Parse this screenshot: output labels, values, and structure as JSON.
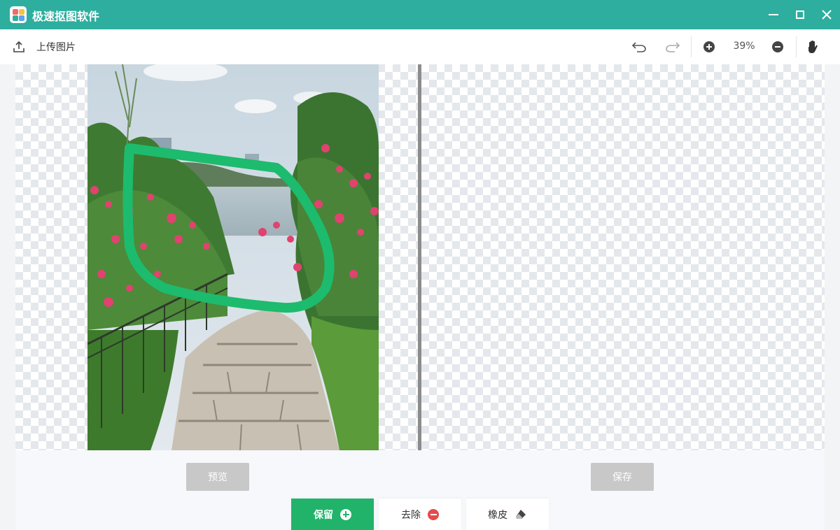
{
  "app": {
    "title": "极速抠图软件",
    "accent_color": "#2eae9f"
  },
  "window_controls": {
    "minimize_icon": "minimize-icon",
    "maximize_icon": "maximize-icon",
    "close_icon": "close-icon"
  },
  "toolbar": {
    "upload_label": "上传图片",
    "zoom_level": "39%",
    "icons": [
      "upload-icon",
      "undo-icon",
      "redo-icon",
      "zoom-in-icon",
      "zoom-out-icon",
      "hand-icon"
    ]
  },
  "actions": {
    "preview_label": "预览",
    "save_label": "保存"
  },
  "modes": {
    "keep_label": "保留",
    "remove_label": "去除",
    "eraser_label": "橡皮",
    "keep_color": "#21b36a",
    "remove_color": "#e74a4a"
  }
}
